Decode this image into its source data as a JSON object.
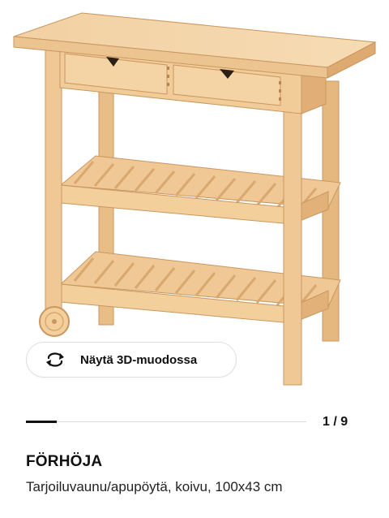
{
  "product": {
    "name": "FÖRHÖJA",
    "description": "Tarjoiluvaunu/apupöytä, koivu, 100x43 cm",
    "image_alt_icon": "kitchen-trolley-illustration"
  },
  "view3d": {
    "label": "Näytä 3D-muodossa",
    "icon": "rotate-3d-icon"
  },
  "gallery": {
    "pager": "1 / 9",
    "current": 1,
    "total": 9,
    "progress_fraction": 0.111
  },
  "colors": {
    "wood_light": "#f3cf9c",
    "wood_mid": "#e7b882",
    "wood_dark": "#c99560",
    "accent_text": "#111111"
  }
}
